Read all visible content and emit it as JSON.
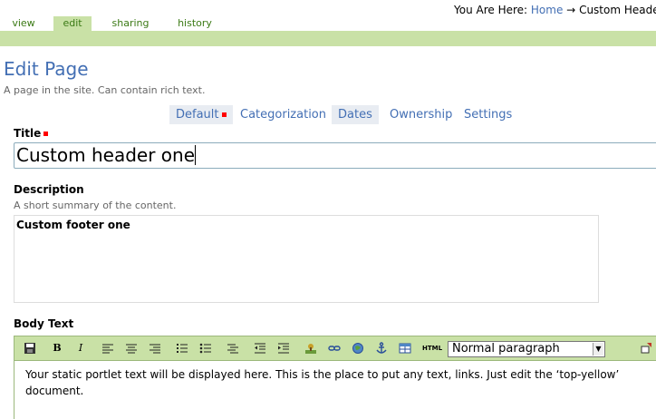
{
  "breadcrumb": {
    "prefix": "You Are Here:",
    "home": "Home",
    "arrow": "→",
    "current": "Custom Heade"
  },
  "content_tabs": [
    {
      "label": "view",
      "active": false
    },
    {
      "label": "edit",
      "active": true
    },
    {
      "label": "sharing",
      "active": false
    },
    {
      "label": "history",
      "active": false
    }
  ],
  "page": {
    "title": "Edit Page",
    "description": "A page in the site. Can contain rich text."
  },
  "form_tabs": [
    "Default",
    "Categorization",
    "Dates",
    "Ownership",
    "Settings"
  ],
  "fields": {
    "title": {
      "label": "Title",
      "value": "Custom header one"
    },
    "description": {
      "label": "Description",
      "help": "A short summary of the content.",
      "value": "Custom footer one"
    },
    "body": {
      "label": "Body Text",
      "format": "Normal paragraph",
      "content": "Your static portlet  text will be displayed here.  This is the place to put any text, links.  Just edit the ‘top-yellow’ document."
    }
  },
  "toolbar_icons": [
    "save-icon",
    "bold-icon",
    "italic-icon",
    "align-left-icon",
    "align-center-icon",
    "align-right-icon",
    "ordered-list-icon",
    "unordered-list-icon",
    "definition-list-icon",
    "outdent-icon",
    "indent-icon",
    "image-icon",
    "link-icon",
    "external-link-icon",
    "anchor-icon",
    "table-icon",
    "html-icon",
    "fullscreen-icon"
  ],
  "toolbar_text": {
    "bold": "B",
    "italic": "I",
    "html": "HTML"
  },
  "colors": {
    "accent": "#436fb4",
    "tab_green": "#c9e1a6",
    "tab_text": "#3b7a15",
    "required": "#ff0000"
  }
}
